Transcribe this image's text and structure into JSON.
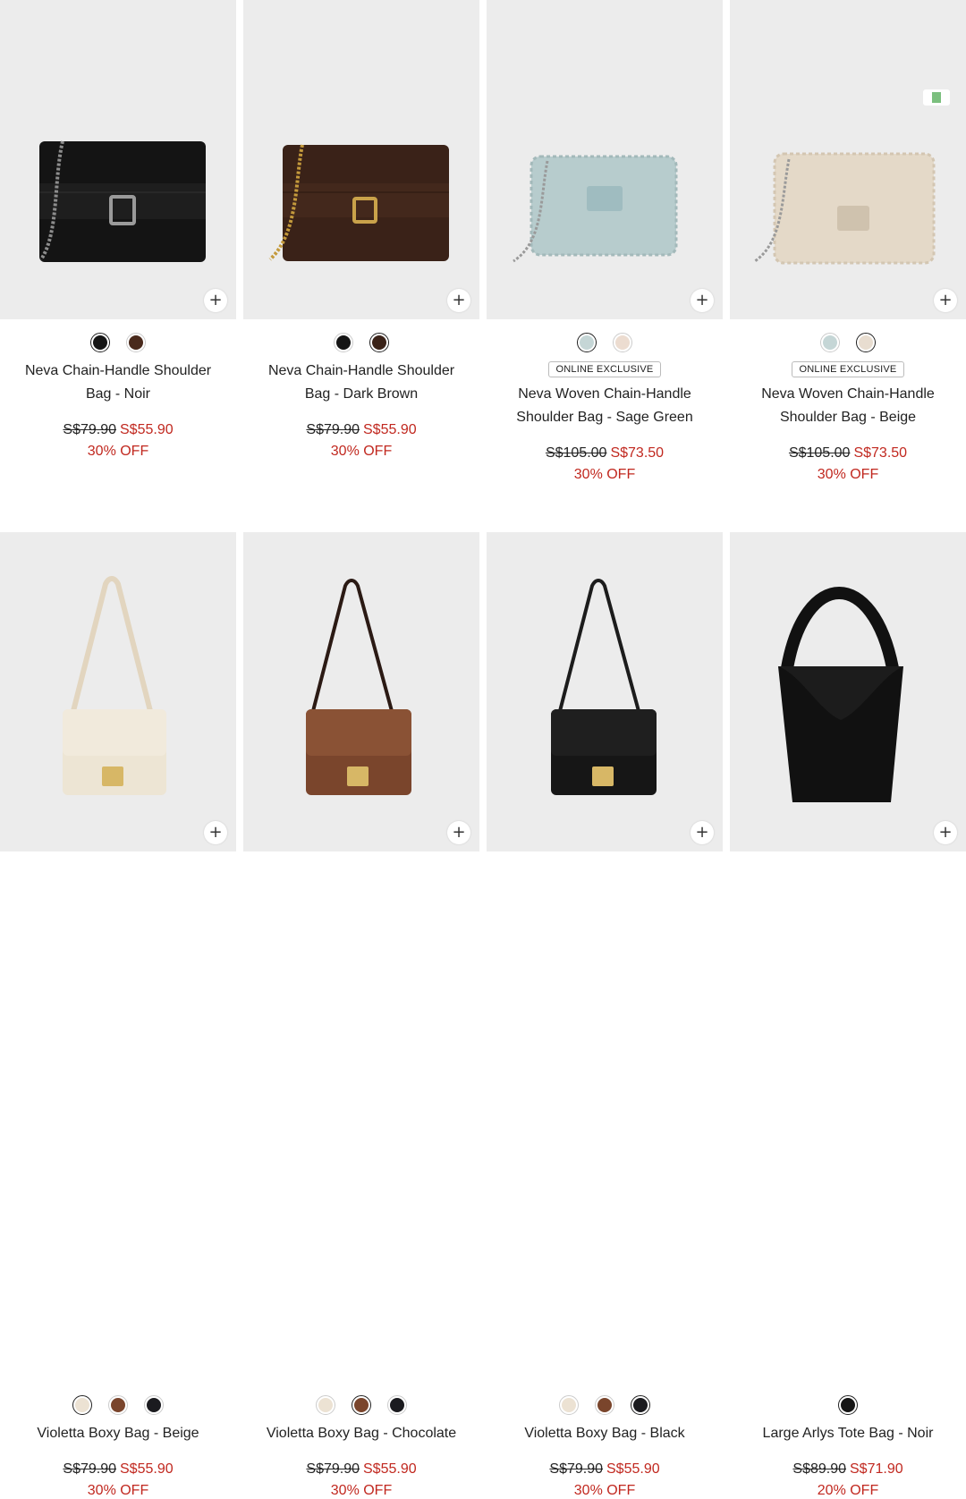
{
  "products": [
    {
      "name": "Neva Chain-Handle Shoulder Bag - Noir",
      "name_l1": "Neva Chain-Handle Shoulder",
      "name_l2": "Bag - Noir",
      "badge": "",
      "old_price": "S$79.90",
      "new_price": "S$55.90",
      "discount": "30% OFF",
      "swatches": [
        "#151515",
        "#4a2a1c"
      ],
      "selected_swatch": 0,
      "image_icon": "black-chain-shoulder-bag"
    },
    {
      "name": "Neva Chain-Handle Shoulder Bag - Dark Brown",
      "name_l1": "Neva Chain-Handle Shoulder",
      "name_l2": "Bag - Dark Brown",
      "badge": "",
      "old_price": "S$79.90",
      "new_price": "S$55.90",
      "discount": "30% OFF",
      "swatches": [
        "#151515",
        "#3a2218"
      ],
      "selected_swatch": 1,
      "image_icon": "brown-chain-shoulder-bag"
    },
    {
      "name": "Neva Woven Chain-Handle Shoulder Bag - Sage Green",
      "name_l1": "Neva Woven Chain-Handle",
      "name_l2": "Shoulder Bag - Sage Green",
      "badge": "ONLINE EXCLUSIVE",
      "old_price": "S$105.00",
      "new_price": "S$73.50",
      "discount": "30% OFF",
      "swatches": [
        "#c5d6d6",
        "#ecdcd0"
      ],
      "selected_swatch": 0,
      "image_icon": "sage-woven-shoulder-bag"
    },
    {
      "name": "Neva Woven Chain-Handle Shoulder Bag - Beige",
      "name_l1": "Neva Woven Chain-Handle",
      "name_l2": "Shoulder Bag - Beige",
      "badge": "ONLINE EXCLUSIVE",
      "old_price": "S$105.00",
      "new_price": "S$73.50",
      "discount": "30% OFF",
      "swatches": [
        "#c5d6d6",
        "#e8ddd0"
      ],
      "selected_swatch": 1,
      "image_icon": "beige-woven-shoulder-bag"
    },
    {
      "name": "Violetta Boxy Bag - Beige",
      "name_l1": "Violetta Boxy Bag - Beige",
      "name_l2": "",
      "badge": "",
      "old_price": "S$79.90",
      "new_price": "S$55.90",
      "discount": "30% OFF",
      "swatches": [
        "#ece2d3",
        "#7a452c",
        "#1b1b1f"
      ],
      "selected_swatch": 0,
      "image_icon": "beige-boxy-bag"
    },
    {
      "name": "Violetta Boxy Bag - Chocolate",
      "name_l1": "Violetta Boxy Bag - Chocolate",
      "name_l2": "",
      "badge": "",
      "old_price": "S$79.90",
      "new_price": "S$55.90",
      "discount": "30% OFF",
      "swatches": [
        "#ece2d3",
        "#7a452c",
        "#1b1b1f"
      ],
      "selected_swatch": 1,
      "image_icon": "chocolate-boxy-bag"
    },
    {
      "name": "Violetta Boxy Bag - Black",
      "name_l1": "Violetta Boxy Bag - Black",
      "name_l2": "",
      "badge": "",
      "old_price": "S$79.90",
      "new_price": "S$55.90",
      "discount": "30% OFF",
      "swatches": [
        "#ece2d3",
        "#7a452c",
        "#1b1b1f"
      ],
      "selected_swatch": 2,
      "image_icon": "black-boxy-bag"
    },
    {
      "name": "Large Arlys Tote Bag - Noir",
      "name_l1": "Large Arlys Tote Bag - Noir",
      "name_l2": "",
      "badge": "",
      "old_price": "S$89.90",
      "new_price": "S$71.90",
      "discount": "20% OFF",
      "swatches": [
        "#151515"
      ],
      "selected_swatch": 0,
      "image_icon": "black-tote-bag"
    }
  ],
  "add_button_icon": "plus-icon",
  "colors": {
    "sale_red": "#c1281f",
    "image_bg": "#ececec"
  }
}
